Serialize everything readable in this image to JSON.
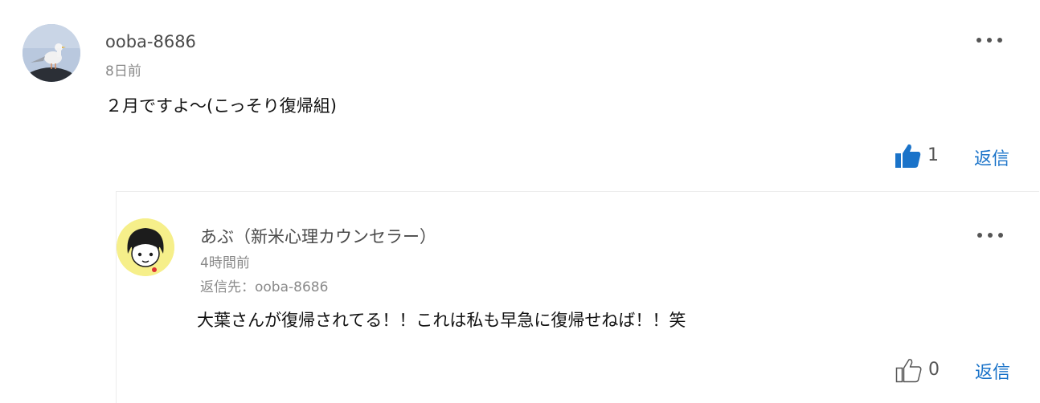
{
  "comments": [
    {
      "username": "ooba-8686",
      "time": "8日前",
      "text": "２月ですよ〜(こっそり復帰組)",
      "like_count": "1",
      "liked": true,
      "reply_label": "返信",
      "avatar_icon": "seagull-photo-avatar",
      "menu_icon": "more-horizontal-icon"
    },
    {
      "username": "あぶ（新米心理カウンセラー）",
      "time": "4時間前",
      "reply_to": "返信先：ooba-8686",
      "text": "大葉さんが復帰されてる！！これは私も早急に復帰せねば！！笑",
      "like_count": "0",
      "liked": false,
      "reply_label": "返信",
      "avatar_icon": "illustrated-person-avatar",
      "menu_icon": "more-horizontal-icon"
    }
  ],
  "colors": {
    "accent": "#1a73c9",
    "liked_thumb": "#1a73c9",
    "unliked_thumb": "#555555",
    "avatar2_bg": "#f6ef8a"
  }
}
